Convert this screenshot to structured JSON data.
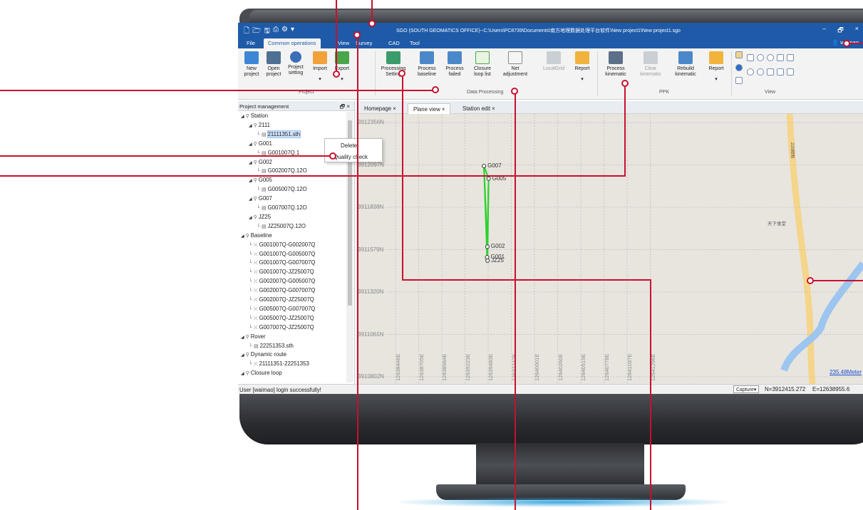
{
  "titlebar": {
    "title": "SGO (SOUTH GEOMATICS OFFICE)--C:\\Users\\PC8739\\Documents\\南方地理数据处理平台软件\\New project1\\New project1.sgo",
    "minimize": "–",
    "restore": "🗗",
    "close": "×"
  },
  "menu": {
    "tabs": [
      "File",
      "Common operations",
      "View",
      "Survey",
      "CAD",
      "Tool"
    ],
    "user": "waimao"
  },
  "ribbon": {
    "project": {
      "label": "Project",
      "buttons": [
        "New\nproject",
        "Open\nproject",
        "Project\nsetting",
        "Import",
        "Export"
      ]
    },
    "data_processing": {
      "label": "Data Processing",
      "buttons": [
        "Processing\nSetting",
        "Process\nbaseline",
        "Process\nfailed",
        "Closure\nloop list",
        "Net\nadjustment",
        "LocalGrid",
        "Report"
      ]
    },
    "ppk": {
      "label": "PPK",
      "buttons": [
        "Process\nkinematic",
        "Clear\nkinematic",
        "Rebuild\nkinematic",
        "Report"
      ]
    },
    "view": {
      "label": "View"
    }
  },
  "panel": {
    "title": "Project management",
    "tree": [
      {
        "label": "Station",
        "level": 0,
        "type": "folder"
      },
      {
        "label": "2111",
        "level": 1,
        "type": "station"
      },
      {
        "label": "21111351.sth",
        "level": 2,
        "type": "file",
        "selected": true
      },
      {
        "label": "G001",
        "level": 1,
        "type": "station"
      },
      {
        "label": "G001007Q.1",
        "level": 2,
        "type": "file"
      },
      {
        "label": "G002",
        "level": 1,
        "type": "station"
      },
      {
        "label": "G002007Q.12O",
        "level": 2,
        "type": "file"
      },
      {
        "label": "G005",
        "level": 1,
        "type": "station"
      },
      {
        "label": "G005007Q.12O",
        "level": 2,
        "type": "file"
      },
      {
        "label": "G007",
        "level": 1,
        "type": "station"
      },
      {
        "label": "G007007Q.12O",
        "level": 2,
        "type": "file"
      },
      {
        "label": "JZ25",
        "level": 1,
        "type": "station"
      },
      {
        "label": "JZ25007Q.12O",
        "level": 2,
        "type": "file"
      },
      {
        "label": "Baseline",
        "level": 0,
        "type": "folder"
      },
      {
        "label": "G001007Q-G002007Q",
        "level": 1,
        "type": "baseline"
      },
      {
        "label": "G001007Q-G005007Q",
        "level": 1,
        "type": "baseline"
      },
      {
        "label": "G001007Q-G007007Q",
        "level": 1,
        "type": "baseline"
      },
      {
        "label": "G001007Q-JZ25007Q",
        "level": 1,
        "type": "baseline"
      },
      {
        "label": "G002007Q-G005007Q",
        "level": 1,
        "type": "baseline"
      },
      {
        "label": "G002007Q-G007007Q",
        "level": 1,
        "type": "baseline"
      },
      {
        "label": "G002007Q-JZ25007Q",
        "level": 1,
        "type": "baseline"
      },
      {
        "label": "G005007Q-G007007Q",
        "level": 1,
        "type": "baseline"
      },
      {
        "label": "G005007Q-JZ25007Q",
        "level": 1,
        "type": "baseline"
      },
      {
        "label": "G007007Q-JZ25007Q",
        "level": 1,
        "type": "baseline"
      },
      {
        "label": "Rover",
        "level": 0,
        "type": "folder"
      },
      {
        "label": "22251353.sth",
        "level": 1,
        "type": "file"
      },
      {
        "label": "Dynamic route",
        "level": 0,
        "type": "folder"
      },
      {
        "label": "21111351-22251353",
        "level": 1,
        "type": "baseline"
      },
      {
        "label": "Closure loop",
        "level": 0,
        "type": "folder"
      }
    ]
  },
  "context_menu": {
    "items": [
      "Delete",
      "Quality check"
    ]
  },
  "doc_tabs": [
    "Homepage ×",
    "Plane view ×",
    "Station edit ×"
  ],
  "map": {
    "n_labels": [
      "3912356N",
      "3912097N",
      "3911838N",
      "3911579N",
      "3911320N",
      "3911061N",
      "3910802N"
    ],
    "e_labels": [
      "12638446E",
      "12638705E",
      "12638964E",
      "12639223E",
      "12639483E",
      "12637742E",
      "12640001E",
      "12640260E",
      "12640519E",
      "12640778E",
      "12641037E",
      "12641296E"
    ],
    "points": [
      {
        "name": "G007",
        "e": 12639435,
        "n": 3912090
      },
      {
        "name": "G005",
        "e": 12639487,
        "n": 3912013
      },
      {
        "name": "G002",
        "e": 12639473,
        "n": 3911597
      },
      {
        "name": "G001",
        "e": 12639470,
        "n": 3911533
      },
      {
        "name": "JZ25",
        "e": 12639475,
        "n": 3911512
      }
    ],
    "scale": "235.48Meter",
    "poi": "天下食堂",
    "road": "220国道"
  },
  "status": {
    "message": "User [waimao] login successfully!",
    "capture": "Capture▾",
    "n": "N=3912415.272",
    "e": "E=12638955.6"
  }
}
